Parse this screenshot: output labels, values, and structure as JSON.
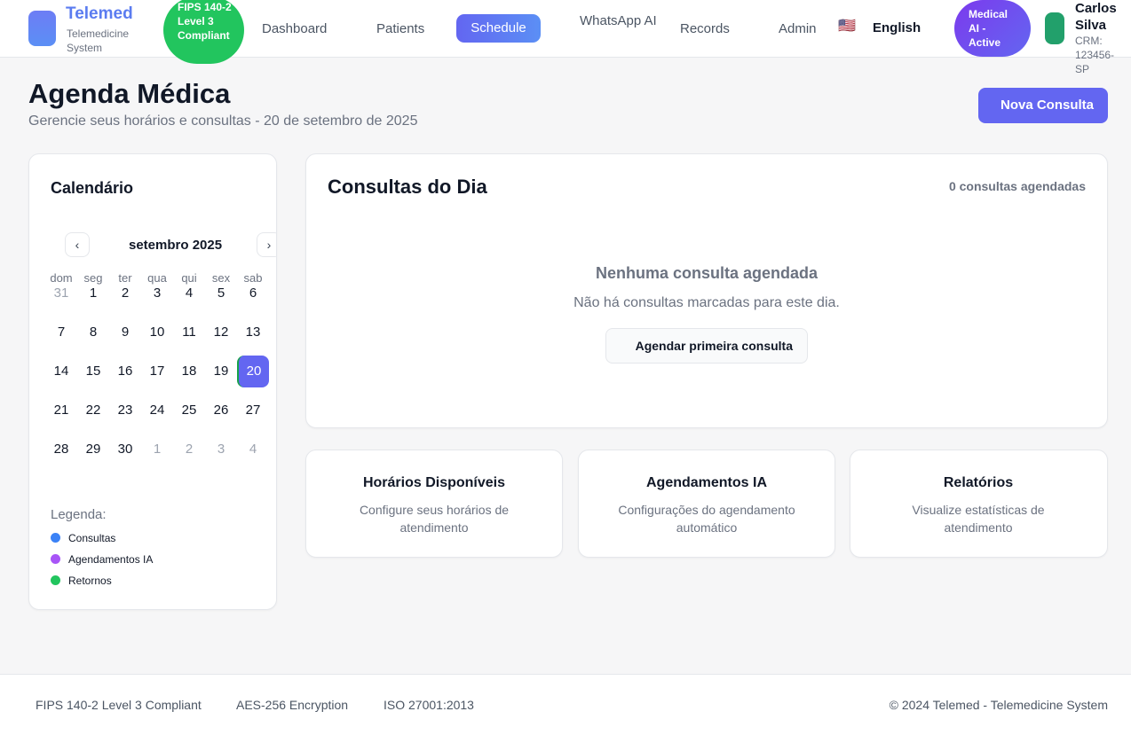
{
  "header": {
    "brand_title": "Telemed",
    "brand_subtitle": "Telemedicine System",
    "fips_badge": "FIPS 140-2 Level 3 Compliant",
    "nav": {
      "dashboard": "Dashboard",
      "patients": "Patients",
      "schedule": "Schedule",
      "whatsapp_ai": "WhatsApp AI",
      "records": "Records",
      "admin": "Admin"
    },
    "language_flag": "🇺🇸",
    "language": "English",
    "ai_badge": [
      "Medical",
      "AI -",
      "Active"
    ],
    "user_name": "Carlos Silva",
    "user_crm": "CRM: 123456-SP"
  },
  "page": {
    "title": "Agenda Médica",
    "subtitle": "Gerencie seus horários e consultas - 20 de setembro de 2025",
    "new_button": "Nova Consulta"
  },
  "calendar": {
    "title": "Calendário",
    "prev_icon": "‹",
    "next_icon": "›",
    "month_label": "setembro 2025",
    "weekdays": [
      "dom",
      "seg",
      "ter",
      "qua",
      "qui",
      "sex",
      "sab"
    ],
    "weeks": [
      [
        "31",
        "1",
        "2",
        "3",
        "4",
        "5",
        "6"
      ],
      [
        "7",
        "8",
        "9",
        "10",
        "11",
        "12",
        "13"
      ],
      [
        "14",
        "15",
        "16",
        "17",
        "18",
        "19",
        "20"
      ],
      [
        "21",
        "22",
        "23",
        "24",
        "25",
        "26",
        "27"
      ],
      [
        "28",
        "29",
        "30",
        "1",
        "2",
        "3",
        "4"
      ]
    ],
    "selected_day": "20",
    "legend_title": "Legenda:",
    "legend": [
      {
        "label": "Consultas",
        "color": "#3b82f6"
      },
      {
        "label": "Agendamentos IA",
        "color": "#a855f7"
      },
      {
        "label": "Retornos",
        "color": "#22c55e"
      }
    ]
  },
  "consultas": {
    "title": "Consultas do Dia",
    "count": "0 consultas agendadas",
    "empty_title": "Nenhuma consulta agendada",
    "empty_subtitle": "Não há consultas marcadas para este dia.",
    "first_button": "Agendar primeira consulta"
  },
  "cards": [
    {
      "title": "Horários Disponíveis",
      "subtitle": "Configure seus horários de atendimento"
    },
    {
      "title": "Agendamentos IA",
      "subtitle": "Configurações do agendamento automático"
    },
    {
      "title": "Relatórios",
      "subtitle": "Visualize estatísticas de atendimento"
    }
  ],
  "footer": {
    "fips": "FIPS 140-2 Level 3 Compliant",
    "aes": "AES-256 Encryption",
    "iso": "ISO 27001:2013",
    "copyright": "© 2024 Telemed - Telemedicine System"
  },
  "colors": {
    "accent": "#6366f1",
    "success": "#22c55e",
    "brand": "#5b7cf0"
  }
}
